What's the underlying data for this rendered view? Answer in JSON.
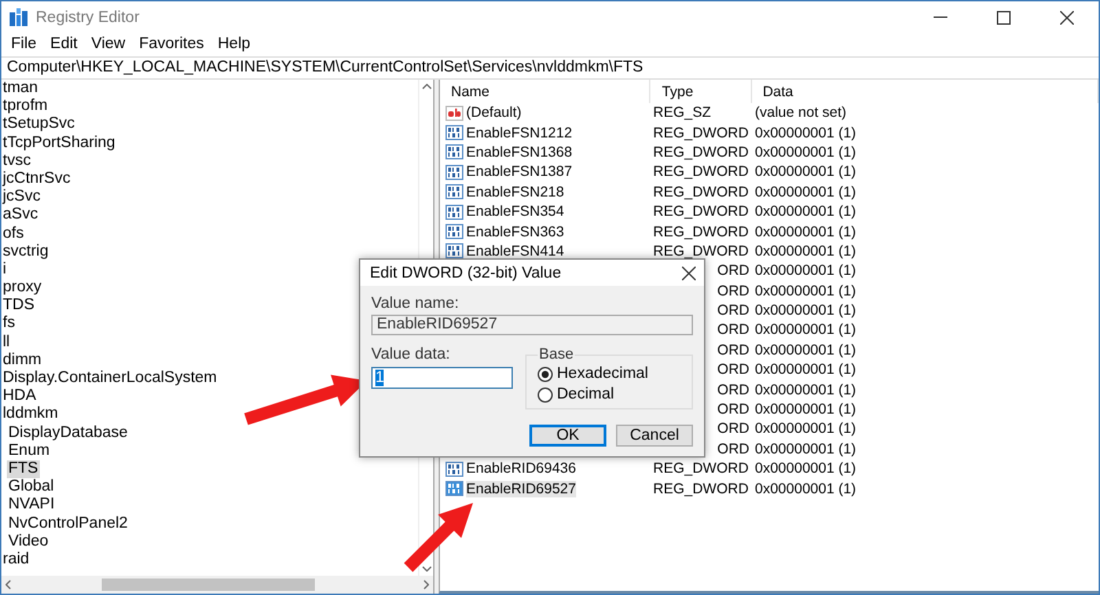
{
  "window": {
    "title": "Registry Editor"
  },
  "menu": [
    "File",
    "Edit",
    "View",
    "Favorites",
    "Help"
  ],
  "address": "Computer\\HKEY_LOCAL_MACHINE\\SYSTEM\\CurrentControlSet\\Services\\nvlddmkm\\FTS",
  "tree": [
    {
      "label": "tman",
      "selected": false
    },
    {
      "label": "tprofm",
      "selected": false
    },
    {
      "label": "tSetupSvc",
      "selected": false
    },
    {
      "label": "tTcpPortSharing",
      "selected": false
    },
    {
      "label": "tvsc",
      "selected": false
    },
    {
      "label": "jcCtnrSvc",
      "selected": false
    },
    {
      "label": "jcSvc",
      "selected": false
    },
    {
      "label": "aSvc",
      "selected": false
    },
    {
      "label": "ofs",
      "selected": false
    },
    {
      "label": "svctrig",
      "selected": false
    },
    {
      "label": "i",
      "selected": false
    },
    {
      "label": "proxy",
      "selected": false
    },
    {
      "label": "TDS",
      "selected": false
    },
    {
      "label": "fs",
      "selected": false
    },
    {
      "label": "ll",
      "selected": false
    },
    {
      "label": "dimm",
      "selected": false
    },
    {
      "label": "Display.ContainerLocalSystem",
      "selected": false
    },
    {
      "label": "HDA",
      "selected": false
    },
    {
      "label": "lddmkm",
      "selected": false,
      "children": [
        {
          "label": "DisplayDatabase",
          "selected": false
        },
        {
          "label": "Enum",
          "selected": false
        },
        {
          "label": "FTS",
          "selected": true
        },
        {
          "label": "Global",
          "selected": false
        },
        {
          "label": "NVAPI",
          "selected": false
        },
        {
          "label": "NvControlPanel2",
          "selected": false
        },
        {
          "label": "Video",
          "selected": false
        }
      ]
    },
    {
      "label": "raid",
      "selected": false
    }
  ],
  "values": {
    "columns": [
      "Name",
      "Type",
      "Data"
    ],
    "rows": [
      {
        "kind": "string",
        "name": "(Default)",
        "type": "REG_SZ",
        "data": "(value not set)",
        "selected": false
      },
      {
        "kind": "dword",
        "name": "EnableFSN1212",
        "type": "REG_DWORD",
        "data": "0x00000001 (1)",
        "selected": false
      },
      {
        "kind": "dword",
        "name": "EnableFSN1368",
        "type": "REG_DWORD",
        "data": "0x00000001 (1)",
        "selected": false
      },
      {
        "kind": "dword",
        "name": "EnableFSN1387",
        "type": "REG_DWORD",
        "data": "0x00000001 (1)",
        "selected": false
      },
      {
        "kind": "dword",
        "name": "EnableFSN218",
        "type": "REG_DWORD",
        "data": "0x00000001 (1)",
        "selected": false
      },
      {
        "kind": "dword",
        "name": "EnableFSN354",
        "type": "REG_DWORD",
        "data": "0x00000001 (1)",
        "selected": false
      },
      {
        "kind": "dword",
        "name": "EnableFSN363",
        "type": "REG_DWORD",
        "data": "0x00000001 (1)",
        "selected": false
      },
      {
        "kind": "dword",
        "name": "EnableFSN414",
        "type": "REG_DWORD",
        "data": "0x00000001 (1)",
        "selected": false
      },
      {
        "kind": "covered",
        "type": "ORD",
        "data": "0x00000001 (1)"
      },
      {
        "kind": "covered",
        "type": "ORD",
        "data": "0x00000001 (1)"
      },
      {
        "kind": "covered",
        "type": "ORD",
        "data": "0x00000001 (1)"
      },
      {
        "kind": "covered",
        "type": "ORD",
        "data": "0x00000001 (1)"
      },
      {
        "kind": "covered",
        "type": "ORD",
        "data": "0x00000001 (1)"
      },
      {
        "kind": "covered",
        "type": "ORD",
        "data": "0x00000001 (1)"
      },
      {
        "kind": "covered",
        "type": "ORD",
        "data": "0x00000001 (1)"
      },
      {
        "kind": "covered",
        "type": "ORD",
        "data": "0x00000001 (1)"
      },
      {
        "kind": "covered",
        "type": "ORD",
        "data": "0x00000001 (1)"
      },
      {
        "kind": "covered",
        "type": "ORD",
        "data": "0x00000001 (1)"
      },
      {
        "kind": "dword",
        "name": "EnableRID69436",
        "type": "REG_DWORD",
        "data": "0x00000001 (1)",
        "selected": false
      },
      {
        "kind": "dword",
        "name": "EnableRID69527",
        "type": "REG_DWORD",
        "data": "0x00000001 (1)",
        "selected": true
      }
    ]
  },
  "dialog": {
    "title": "Edit DWORD (32-bit) Value",
    "value_name_label": "Value name:",
    "value_name": "EnableRID69527",
    "value_data_label": "Value data:",
    "value_data": "1",
    "base_label": "Base",
    "base_options": [
      {
        "label": "Hexadecimal",
        "selected": true
      },
      {
        "label": "Decimal",
        "selected": false
      }
    ],
    "buttons": [
      {
        "label": "OK",
        "default": true
      },
      {
        "label": "Cancel",
        "default": false
      }
    ]
  }
}
